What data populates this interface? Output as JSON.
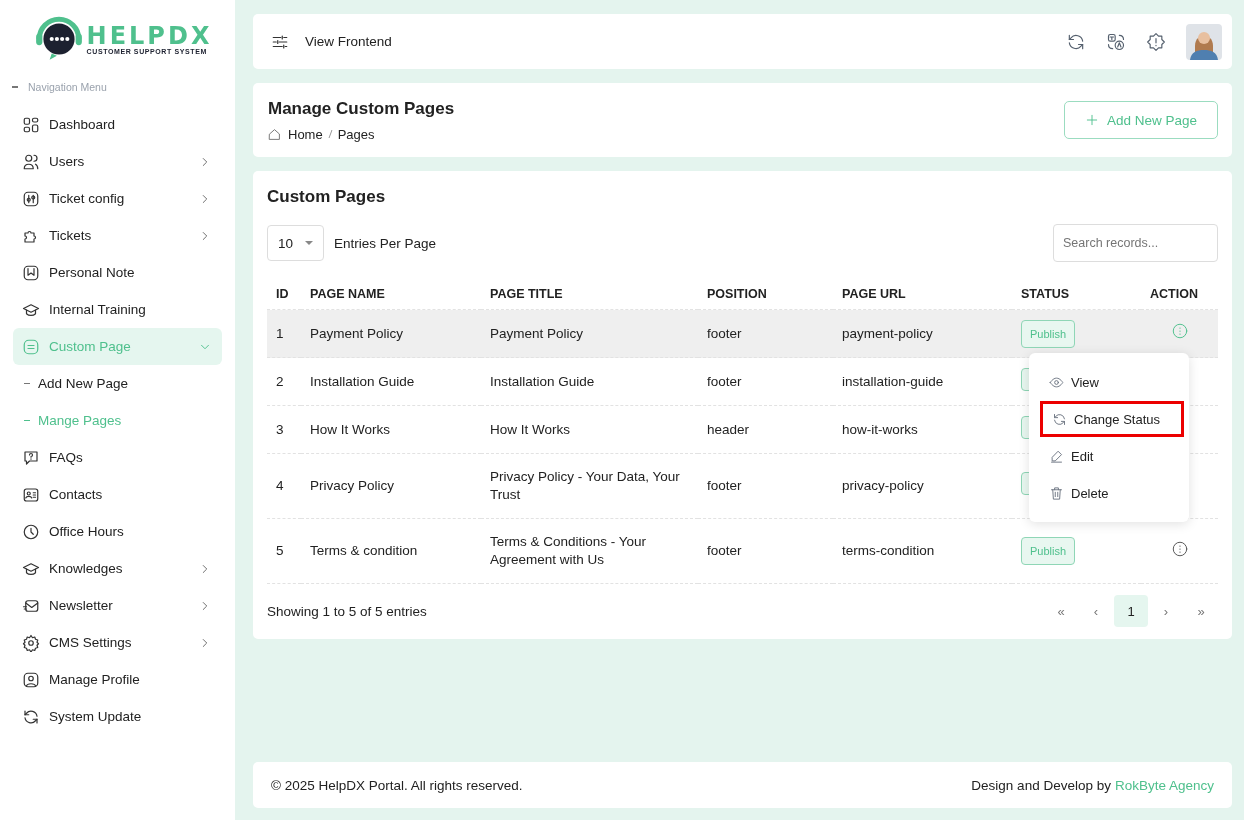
{
  "logo": {
    "name": "HELPDX",
    "tagline": "CUSTOMER SUPPORT SYSTEM"
  },
  "sidebar": {
    "heading": "Navigation Menu",
    "items": [
      {
        "label": "Dashboard",
        "has_submenu": false,
        "selected": false
      },
      {
        "label": "Users",
        "has_submenu": true,
        "selected": false
      },
      {
        "label": "Ticket config",
        "has_submenu": true,
        "selected": false
      },
      {
        "label": "Tickets",
        "has_submenu": true,
        "selected": false
      },
      {
        "label": "Personal Note",
        "has_submenu": false,
        "selected": false
      },
      {
        "label": "Internal Training",
        "has_submenu": false,
        "selected": false
      },
      {
        "label": "Custom Page",
        "has_submenu": true,
        "selected": true,
        "expanded": true,
        "children": [
          {
            "label": "Add New Page",
            "selected": false
          },
          {
            "label": "Mange Pages",
            "selected": true
          }
        ]
      },
      {
        "label": "FAQs",
        "has_submenu": false,
        "selected": false
      },
      {
        "label": "Contacts",
        "has_submenu": false,
        "selected": false
      },
      {
        "label": "Office Hours",
        "has_submenu": false,
        "selected": false
      },
      {
        "label": "Knowledges",
        "has_submenu": true,
        "selected": false
      },
      {
        "label": "Newsletter",
        "has_submenu": true,
        "selected": false
      },
      {
        "label": "CMS Settings",
        "has_submenu": true,
        "selected": false
      },
      {
        "label": "Manage Profile",
        "has_submenu": false,
        "selected": false
      },
      {
        "label": "System Update",
        "has_submenu": false,
        "selected": false
      }
    ]
  },
  "topbar": {
    "link": "View Frontend"
  },
  "page_header": {
    "title": "Manage Custom Pages",
    "breadcrumb": [
      "Home",
      "Pages"
    ],
    "button": "Add New Page"
  },
  "table_card": {
    "title": "Custom Pages",
    "entries": "10",
    "entries_label": "Entries Per Page",
    "search_placeholder": "Search records...",
    "columns": [
      "ID",
      "PAGE NAME",
      "PAGE TITLE",
      "POSITION",
      "PAGE URL",
      "STATUS",
      "ACTION"
    ],
    "rows": [
      {
        "id": "1",
        "name": "Payment Policy",
        "title": "Payment Policy",
        "position": "footer",
        "url": "payment-policy",
        "status": "Publish",
        "selected": true
      },
      {
        "id": "2",
        "name": "Installation Guide",
        "title": "Installation Guide",
        "position": "footer",
        "url": "installation-guide",
        "status_covered": true,
        "selected": false
      },
      {
        "id": "3",
        "name": "How It Works",
        "title": "How It Works",
        "position": "header",
        "url": "how-it-works",
        "status_covered": true,
        "selected": false
      },
      {
        "id": "4",
        "name": "Privacy Policy",
        "title": "Privacy Policy - Your Data, Your Trust",
        "position": "footer",
        "url": "privacy-policy",
        "status_covered": true,
        "selected": false
      },
      {
        "id": "5",
        "name": "Terms & condition",
        "title": "Terms & Conditions - Your Agreement with Us",
        "position": "footer",
        "url": "terms-condition",
        "status": "Publish",
        "selected": false
      }
    ],
    "action_menu": [
      {
        "label": "View",
        "highlighted": false
      },
      {
        "label": "Change Status",
        "highlighted": true
      },
      {
        "label": "Edit",
        "highlighted": false
      },
      {
        "label": "Delete",
        "highlighted": false
      }
    ],
    "summary": "Showing 1 to 5 of 5 entries",
    "pagination": [
      {
        "label": "«",
        "selected": false
      },
      {
        "label": "‹",
        "selected": false
      },
      {
        "label": "1",
        "selected": true
      },
      {
        "label": "›",
        "selected": false
      },
      {
        "label": "»",
        "selected": false
      }
    ]
  },
  "footer": {
    "copyright": "© 2025 HelpDX Portal. All rights reserved.",
    "credit": "Design and Develop by",
    "credit_link": "RokByte Agency"
  }
}
